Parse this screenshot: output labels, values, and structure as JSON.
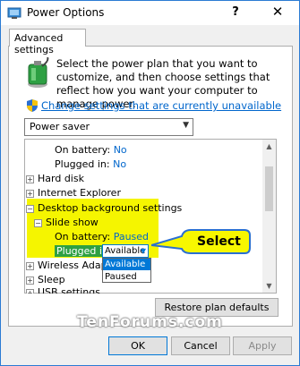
{
  "window": {
    "title": "Power Options",
    "help_label": "?",
    "close_label": "✕"
  },
  "tab": {
    "label": "Advanced settings"
  },
  "description": "Select the power plan that you want to customize, and then choose settings that reflect how you want your computer to manage power.",
  "change_link": "Change settings that are currently unavailable",
  "plan": {
    "selected": "Power saver"
  },
  "tree": {
    "rows": [
      {
        "label": "On battery:",
        "value": "No"
      },
      {
        "label": "Plugged in:",
        "value": "No"
      },
      {
        "label": "Hard disk"
      },
      {
        "label": "Internet Explorer"
      },
      {
        "label": "Desktop background settings"
      },
      {
        "label": "Slide show"
      },
      {
        "label": "On battery:",
        "value": "Paused"
      },
      {
        "label": "Plugged in:",
        "value": "Available"
      },
      {
        "label": "Wireless Adapter"
      },
      {
        "label": "Sleep"
      },
      {
        "label": "USB settings"
      }
    ],
    "expand_plus": "+",
    "expand_minus": "−"
  },
  "dropdown": {
    "options": [
      "Available",
      "Paused"
    ],
    "selected_index": 0
  },
  "callout": {
    "text": "Select"
  },
  "buttons": {
    "restore": "Restore plan defaults",
    "ok": "OK",
    "cancel": "Cancel",
    "apply": "Apply"
  },
  "watermark": "TenForums.com",
  "colors": {
    "accent": "#0078d7",
    "link": "#0066cc",
    "highlight": "#f5f500",
    "callout": "#f7f700"
  }
}
